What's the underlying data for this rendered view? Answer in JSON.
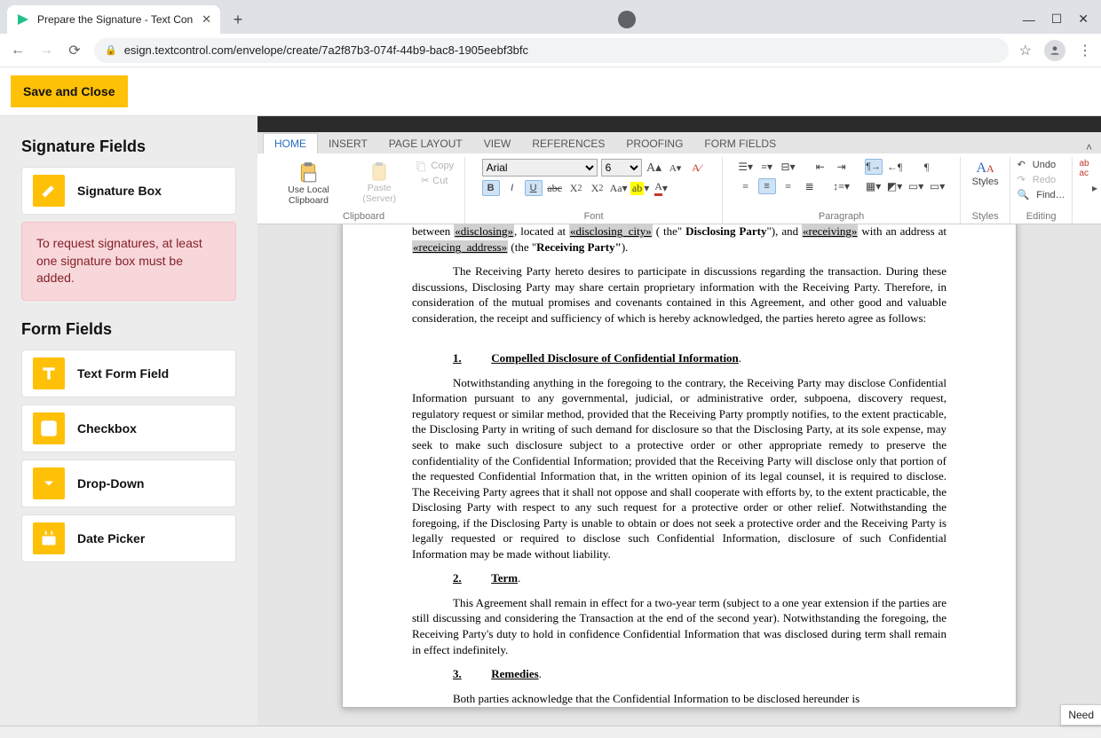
{
  "browser": {
    "tab_title": "Prepare the Signature - Text Con",
    "url": "esign.textcontrol.com/envelope/create/7a2f87b3-074f-44b9-bac8-1905eebf3bfc"
  },
  "app": {
    "save_button": "Save and Close"
  },
  "sidebar": {
    "signature_heading": "Signature Fields",
    "signature_box_label": "Signature Box",
    "alert_text": "To request signatures, at least one signature box must be added.",
    "form_heading": "Form Fields",
    "fields": [
      {
        "label": "Text Form Field"
      },
      {
        "label": "Checkbox"
      },
      {
        "label": "Drop-Down"
      },
      {
        "label": "Date Picker"
      }
    ]
  },
  "ribbon": {
    "tabs": [
      "HOME",
      "INSERT",
      "PAGE LAYOUT",
      "VIEW",
      "REFERENCES",
      "PROOFING",
      "FORM FIELDS"
    ],
    "active_tab": "HOME",
    "clipboard": {
      "local": "Use Local Clipboard",
      "paste": "Paste (Server)",
      "copy": "Copy",
      "cut": "Cut",
      "group": "Clipboard"
    },
    "font": {
      "family": "Arial",
      "size": "6",
      "group": "Font"
    },
    "paragraph": {
      "group": "Paragraph"
    },
    "styles": {
      "label": "Styles",
      "group": "Styles"
    },
    "editing": {
      "undo": "Undo",
      "redo": "Redo",
      "find": "Find…",
      "group": "Editing"
    }
  },
  "document": {
    "p1_a": "between ",
    "p1_m1": "«disclosing»",
    "p1_b": ", located at ",
    "p1_m2": "«disclosing_city»",
    "p1_c": " ( the\" ",
    "p1_bold1": "Disclosing Party",
    "p1_d": "\"), and ",
    "p1_m3": "«receiving»",
    "p1_e": " with an address at ",
    "p1_m4": "«receicing_address»",
    "p1_f": " (the \"",
    "p1_bold2": "Receiving Party\"",
    "p1_g": ").",
    "p2": "The Receiving Party hereto desires to participate in discussions regarding the transaction.  During these discussions, Disclosing Party may share certain proprietary information with the Receiving Party.   Therefore, in consideration of the mutual promises and covenants contained in this Agreement, and other good and valuable consideration, the receipt and sufficiency of which is hereby acknowledged, the parties hereto agree as follows:",
    "s1_num": "1.",
    "s1_title": "Compelled Disclosure of Confidential Information",
    "s1_body": "Notwithstanding anything in the foregoing to the contrary, the Receiving Party may disclose Confidential Information pursuant to any governmental, judicial, or administrative order, subpoena, discovery request, regulatory request or similar method, provided that the Receiving Party promptly notifies, to the extent practicable, the Disclosing Party in writing of such demand for disclosure so that the Disclosing Party, at its sole expense, may seek to make such disclosure subject to a protective order or other appropriate remedy to preserve the confidentiality of the Confidential Information; provided that the Receiving Party will disclose only that portion of the requested Confidential Information that, in the written opinion of its legal counsel, it is required to disclose.  The Receiving Party agrees that it shall not oppose and shall cooperate with efforts by, to the extent practicable, the Disclosing Party with respect to any such request for a protective order or other relief.  Notwithstanding the foregoing, if the Disclosing Party is unable to obtain or does not seek a protective order and the Receiving Party is legally requested or required to disclose such Confidential Information, disclosure of such Confidential Information may be made without liability.",
    "s2_num": "2.",
    "s2_title": "Term",
    "s2_body": "This Agreement shall remain in effect for a two-year term (subject to a one year extension if the parties are still discussing and considering the Transaction at the end of the second year).  Notwithstanding the foregoing, the Receiving Party's duty to hold in confidence Confidential Information that was disclosed during term shall remain in effect indefinitely.",
    "s3_num": "3.",
    "s3_title": "Remedies",
    "s3_body_cut": "Both parties acknowledge that the Confidential Information to be disclosed hereunder is"
  },
  "help": {
    "label": "Need"
  }
}
